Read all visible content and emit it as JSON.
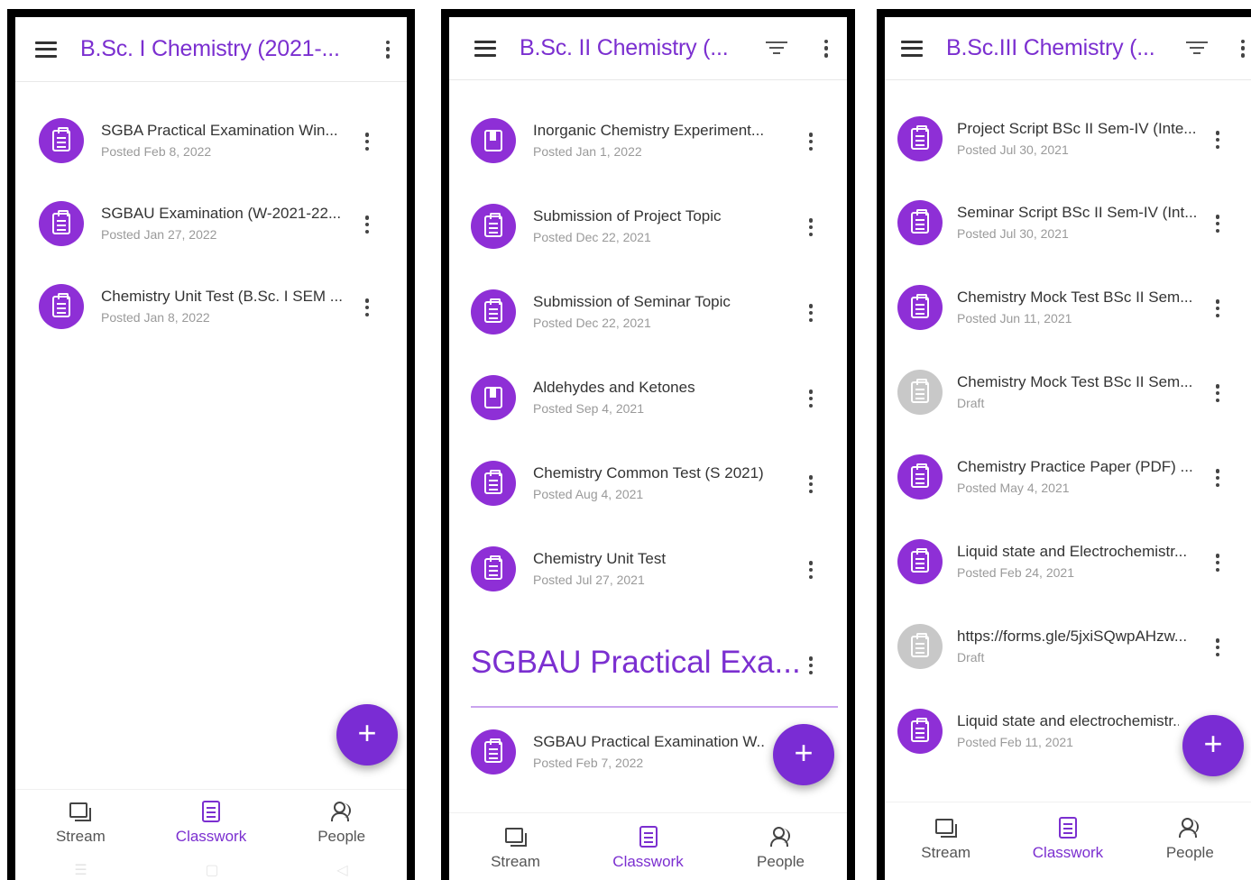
{
  "colors": {
    "accent": "#7b2fd0",
    "icon_bg": "#8e2fd6",
    "draft_bg": "#c8c8c8",
    "fab": "#7a2cd4"
  },
  "phones": [
    {
      "title": "B.Sc. I Chemistry (2021-...",
      "items": [
        {
          "icon": "assignment-icon",
          "title": "SGBA Practical Examination Win...",
          "sub": "Posted Feb 8, 2022"
        },
        {
          "icon": "assignment-icon",
          "title": "SGBAU Examination (W-2021-22...",
          "sub": "Posted Jan 27, 2022"
        },
        {
          "icon": "assignment-icon",
          "title": "Chemistry Unit Test (B.Sc. I SEM ...",
          "sub": "Posted Jan 8, 2022"
        }
      ],
      "nav": {
        "stream": "Stream",
        "classwork": "Classwork",
        "people": "People"
      },
      "sysnav": [
        "☰",
        "▢",
        "◁"
      ]
    },
    {
      "title": "B.Sc. II Chemistry (...",
      "items": [
        {
          "icon": "material-icon",
          "title": "Inorganic Chemistry Experiment...",
          "sub": "Posted Jan 1, 2022"
        },
        {
          "icon": "assignment-icon",
          "title": "Submission of Project Topic",
          "sub": "Posted Dec 22, 2021"
        },
        {
          "icon": "assignment-icon",
          "title": "Submission of Seminar Topic",
          "sub": "Posted Dec 22, 2021"
        },
        {
          "icon": "material-icon",
          "title": "Aldehydes and Ketones",
          "sub": "Posted Sep 4, 2021"
        },
        {
          "icon": "assignment-icon",
          "title": "Chemistry Common Test (S 2021)",
          "sub": "Posted Aug 4, 2021"
        },
        {
          "icon": "assignment-icon",
          "title": "Chemistry Unit Test",
          "sub": "Posted Jul 27, 2021"
        }
      ],
      "section": {
        "title": "SGBAU Practical Exa...",
        "items": [
          {
            "icon": "assignment-icon",
            "title": "SGBAU Practical Examination W...",
            "sub": "Posted Feb 7, 2022"
          }
        ]
      },
      "nav": {
        "stream": "Stream",
        "classwork": "Classwork",
        "people": "People"
      }
    },
    {
      "title": "B.Sc.III Chemistry (...",
      "items": [
        {
          "icon": "assignment-icon",
          "title": "Project Script BSc II Sem-IV (Inte...",
          "sub": "Posted Jul 30, 2021"
        },
        {
          "icon": "assignment-icon",
          "title": "Seminar Script BSc II Sem-IV (Int...",
          "sub": "Posted Jul 30, 2021"
        },
        {
          "icon": "assignment-icon",
          "title": "Chemistry Mock Test BSc II Sem...",
          "sub": "Posted Jun 11, 2021"
        },
        {
          "icon": "assignment-icon",
          "draft": true,
          "title": "Chemistry Mock Test BSc II Sem...",
          "sub": "Draft"
        },
        {
          "icon": "assignment-icon",
          "title": "Chemistry Practice Paper (PDF) ...",
          "sub": "Posted May 4, 2021"
        },
        {
          "icon": "assignment-icon",
          "title": "Liquid state and Electrochemistr...",
          "sub": "Posted Feb 24, 2021"
        },
        {
          "icon": "assignment-icon",
          "draft": true,
          "title": "https://forms.gle/5jxiSQwpAHzw...",
          "sub": "Draft"
        },
        {
          "icon": "assignment-icon",
          "title": "Liquid state and electrochemistr...",
          "sub": "Posted Feb 11, 2021"
        }
      ],
      "nav": {
        "stream": "Stream",
        "classwork": "Classwork",
        "people": "People"
      }
    }
  ],
  "fab_label": "+"
}
